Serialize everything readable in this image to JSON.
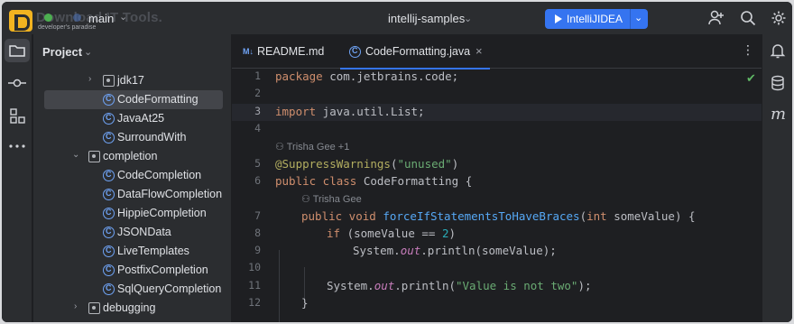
{
  "titlebar": {
    "watermark": "Download IT Tools.",
    "watermark_sub": "developer's paradise",
    "branch": "main",
    "project_name": "intellij-samples",
    "run_config": "IntelliJIDEA"
  },
  "project_panel": {
    "title": "Project",
    "items": [
      {
        "label": "jdk17",
        "type": "package",
        "expanded": false
      },
      {
        "label": "CodeFormatting",
        "type": "class",
        "selected": true
      },
      {
        "label": "JavaAt25",
        "type": "class"
      },
      {
        "label": "SurroundWith",
        "type": "class"
      },
      {
        "label": "completion",
        "type": "package",
        "expanded": true
      },
      {
        "label": "CodeCompletion",
        "type": "class"
      },
      {
        "label": "DataFlowCompletion",
        "type": "class"
      },
      {
        "label": "HippieCompletion",
        "type": "class"
      },
      {
        "label": "JSONData",
        "type": "class"
      },
      {
        "label": "LiveTemplates",
        "type": "class"
      },
      {
        "label": "PostfixCompletion",
        "type": "class"
      },
      {
        "label": "SqlQueryCompletion",
        "type": "class"
      },
      {
        "label": "debugging",
        "type": "package",
        "expanded": false
      }
    ]
  },
  "editor": {
    "tabs": [
      {
        "icon": "M↓",
        "label": "README.md",
        "active": false
      },
      {
        "label": "CodeFormatting.java",
        "active": true,
        "close": "×"
      }
    ],
    "line_numbers": [
      "1",
      "2",
      "3",
      "4",
      "5",
      "6",
      "7",
      "8",
      "9",
      "10",
      "11",
      "12"
    ],
    "code": {
      "l1_kw": "package",
      "l1_rest": " com.jetbrains.code;",
      "l3_kw": "import",
      "l3_rest": " java.util.List;",
      "inlay1": "Trisha Gee +1",
      "l5_ann": "@SuppressWarnings",
      "l5_open": "(",
      "l5_str": "\"unused\"",
      "l5_close": ")",
      "l6_kw": "public class",
      "l6_rest": " CodeFormatting {",
      "inlay2": "Trisha Gee",
      "l7_kw1": "public void",
      "l7_fn": "forceIfStatementsToHaveBraces",
      "l7_open": "(",
      "l7_kw2": "int",
      "l7_rest": " someValue) {",
      "l8_kw": "if",
      "l8_rest": " (someValue == ",
      "l8_num": "2",
      "l8_close": ")",
      "l9_pre": "System.",
      "l9_fld": "out",
      "l9_rest": ".println(someValue);",
      "l11_pre": "System.",
      "l11_fld": "out",
      "l11_mid": ".println(",
      "l11_str": "\"Value is not two\"",
      "l11_end": ");",
      "l12": "}"
    }
  },
  "colors": {
    "accent": "#3574f0",
    "keyword": "#cf8e6d",
    "string": "#6aab73",
    "annotation": "#b3ae60",
    "function": "#56a8f5"
  }
}
